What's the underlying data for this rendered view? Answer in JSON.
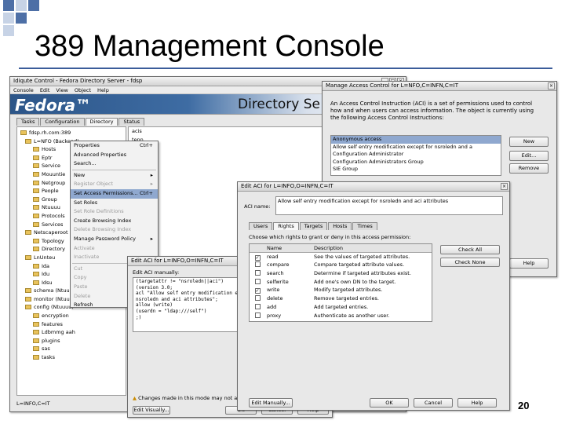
{
  "slide": {
    "title": "389 Management Console",
    "page_number": "20"
  },
  "console": {
    "window_title": "Idiqute Control - Fedora Directory Server - fdsp",
    "menu": [
      "Console",
      "Edit",
      "View",
      "Object",
      "Help"
    ],
    "brand": "Fedora™",
    "banner_title": "Directory Se",
    "tabs": [
      "Tasks",
      "Configuration",
      "Directory",
      "Status"
    ],
    "tree": [
      "fdsp.rh.com:389",
      "L=NFO (Backend)",
      "Hosts",
      "Eptr",
      "Service",
      "Mouuntie",
      "Netgroup",
      "People",
      "Group",
      "Ntuuuu",
      "Protocols",
      "Services",
      "Netscaperoot",
      "Topology",
      "Directory",
      "LnUnteu",
      "Ida",
      "Idu",
      "Idsu",
      "schema (Ntuuuu)",
      "monitor (Ntuuuu)",
      "config (Ntuuuu)",
      "encryption",
      "features",
      "Ldbmmg aah",
      "plugins",
      "sas",
      "tasks"
    ],
    "right_column": [
      "acis",
      "tenn"
    ],
    "status_text": "L=INFO,C=IT"
  },
  "context_menu": {
    "items": [
      {
        "label": "Properties",
        "shortcut": "Ctrl+",
        "disabled": false,
        "highlight": false,
        "sub": false
      },
      {
        "label": "Advanced Properties",
        "shortcut": "",
        "disabled": false,
        "highlight": false,
        "sub": false
      },
      {
        "label": "Search...",
        "shortcut": "",
        "disabled": false,
        "highlight": false,
        "sub": false
      },
      {
        "label": "New",
        "shortcut": "",
        "disabled": false,
        "highlight": false,
        "sub": true
      },
      {
        "label": "Register Object",
        "shortcut": "",
        "disabled": true,
        "highlight": false,
        "sub": true
      },
      {
        "label": "Set Access Permissions...",
        "shortcut": "Ctrl+",
        "disabled": false,
        "highlight": true,
        "sub": false
      },
      {
        "label": "Set Roles",
        "shortcut": "",
        "disabled": false,
        "highlight": false,
        "sub": false
      },
      {
        "label": "Set Role Definitions",
        "shortcut": "",
        "disabled": true,
        "highlight": false,
        "sub": false
      },
      {
        "label": "Create Browsing Index",
        "shortcut": "",
        "disabled": false,
        "highlight": false,
        "sub": false
      },
      {
        "label": "Delete Browsing Index",
        "shortcut": "",
        "disabled": true,
        "highlight": false,
        "sub": false
      },
      {
        "label": "Manage Password Policy",
        "shortcut": "",
        "disabled": false,
        "highlight": false,
        "sub": true
      },
      {
        "label": "Activate",
        "shortcut": "",
        "disabled": true,
        "highlight": false,
        "sub": false
      },
      {
        "label": "Inactivate",
        "shortcut": "",
        "disabled": true,
        "highlight": false,
        "sub": false
      },
      {
        "label": "Cut",
        "shortcut": "",
        "disabled": true,
        "highlight": false,
        "sub": false
      },
      {
        "label": "Copy",
        "shortcut": "",
        "disabled": true,
        "highlight": false,
        "sub": false
      },
      {
        "label": "Paste",
        "shortcut": "",
        "disabled": true,
        "highlight": false,
        "sub": false
      },
      {
        "label": "Delete",
        "shortcut": "",
        "disabled": true,
        "highlight": false,
        "sub": false
      },
      {
        "label": "Refresh",
        "shortcut": "",
        "disabled": false,
        "highlight": false,
        "sub": false
      }
    ]
  },
  "manage_dialog": {
    "title": "Manage Access Control for L=NFO,C=INFN,C=IT",
    "description": "An Access Control Instruction (ACI) is a set of permissions used to control how and when users can access information. The object is currently using the following Access Control Instructions:",
    "acis": [
      "Anonymous access",
      "Allow self entry modification except for nsroledn and a",
      "Configuration Administrator",
      "Configuration Administrators Group",
      "SIE Group"
    ],
    "buttons": {
      "new": "New",
      "edit": "Edit...",
      "remove": "Remove",
      "help": "Help"
    }
  },
  "edit_aci_dialog": {
    "title": "Edit ACI for L=INFO,O=INFN,C=IT",
    "aci_name_label": "ACI name:",
    "aci_name_value": "Allow self entry modification except for nsroledn and aci attributes",
    "tabs": [
      "Users",
      "Rights",
      "Targets",
      "Hosts",
      "Times"
    ],
    "instruction": "Choose which rights to grant or deny in this access permission:",
    "columns": [
      "",
      "Name",
      "Description"
    ],
    "rights": [
      {
        "checked": true,
        "name": "read",
        "description": "See the values of targeted attributes."
      },
      {
        "checked": false,
        "name": "compare",
        "description": "Compare targeted attribute values."
      },
      {
        "checked": false,
        "name": "search",
        "description": "Determine if targeted attributes exist."
      },
      {
        "checked": false,
        "name": "selfwrite",
        "description": "Add one's own DN to the target."
      },
      {
        "checked": true,
        "name": "write",
        "description": "Modify targeted attributes."
      },
      {
        "checked": false,
        "name": "delete",
        "description": "Remove targeted entries."
      },
      {
        "checked": false,
        "name": "add",
        "description": "Add targeted entries."
      },
      {
        "checked": false,
        "name": "proxy",
        "description": "Authenticate as another user."
      }
    ],
    "buttons": {
      "check_all": "Check All",
      "check_none": "Check None",
      "help": "Help",
      "edit_manually": "Edit Manually...",
      "ok": "OK",
      "cancel": "Cancel"
    }
  },
  "manual_dialog": {
    "title": "Edit ACI for L=INFO,O=INFN,C=IT",
    "label": "Edit ACI manually:",
    "code": "(targetattr != \"nsroledn||aci\")\n(version 3.0;\nacl \"Allow self entry modification ex\nnsroledn and aci attributes\";\nallow (write)\n(userdn = \"ldap:///self\")\n;)",
    "warning": "Changes made in this mode may not appear while editing visually.",
    "buttons": {
      "edit_visually": "Edit Visually...",
      "ok": "OK",
      "cancel": "Cancel",
      "help": "Help"
    }
  }
}
